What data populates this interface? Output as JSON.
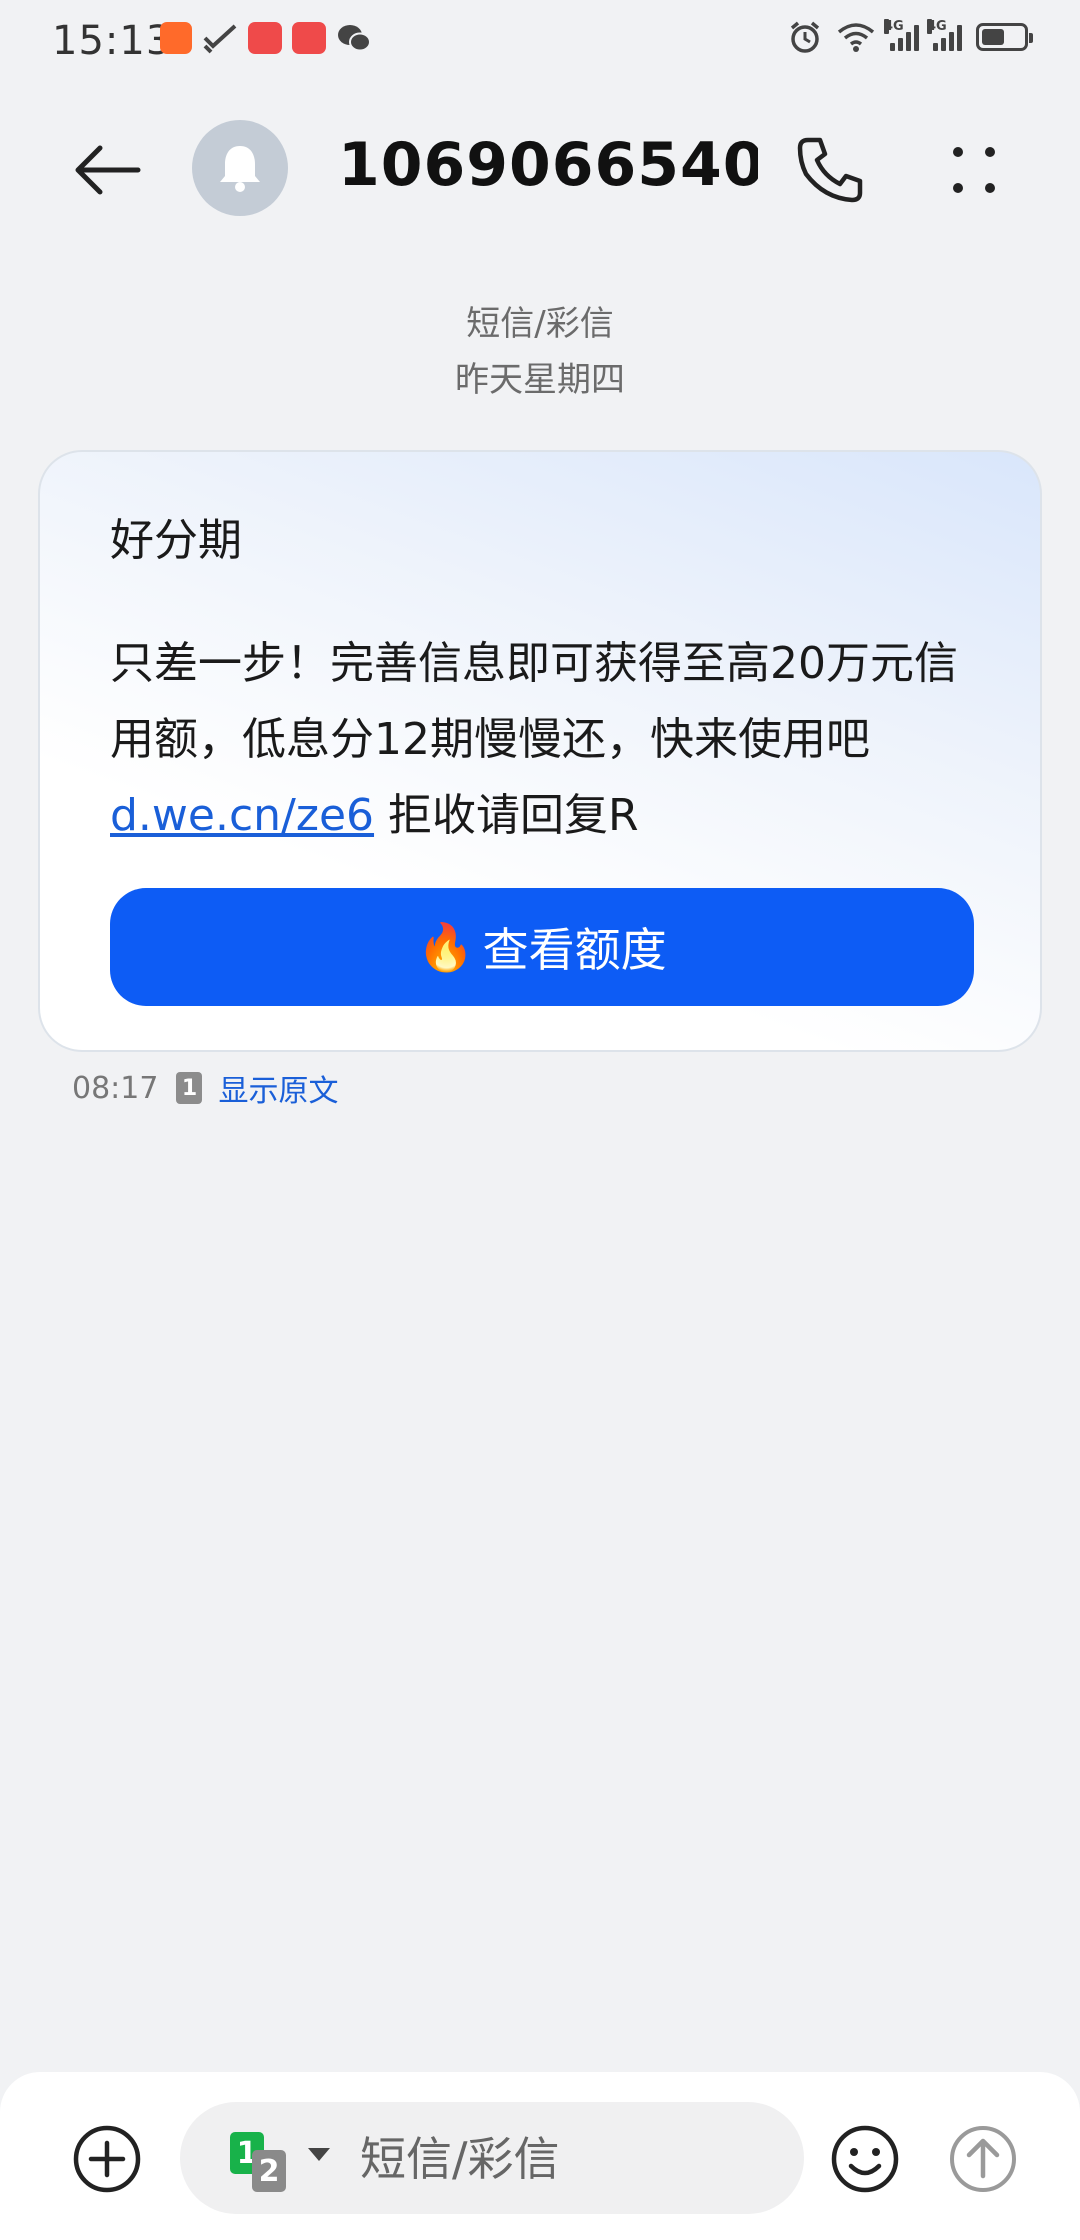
{
  "status_bar": {
    "time": "15:13",
    "network_1": "4G",
    "network_2": "4G",
    "battery_level": 0.55
  },
  "header": {
    "contact_name": "1069066540..."
  },
  "conversation": {
    "message_type": "短信/彩信",
    "date_label": "昨天星期四"
  },
  "message": {
    "title": "好分期",
    "body_before_link": "只差一步！完善信息即可获得至高20万元信用额，低息分12期慢慢还，快来使用吧 ",
    "link_text": "d.we.cn/ze6",
    "body_after_link": " 拒收请回复R",
    "cta_label": "查看额度",
    "time": "08:17",
    "sim_slot": "1",
    "show_original_label": "显示原文"
  },
  "compose": {
    "sim_primary": "1",
    "sim_secondary": "2",
    "placeholder": "短信/彩信"
  },
  "colors": {
    "accent": "#0d5cf5",
    "link": "#1a5fd8",
    "sim_green": "#18b24a"
  }
}
